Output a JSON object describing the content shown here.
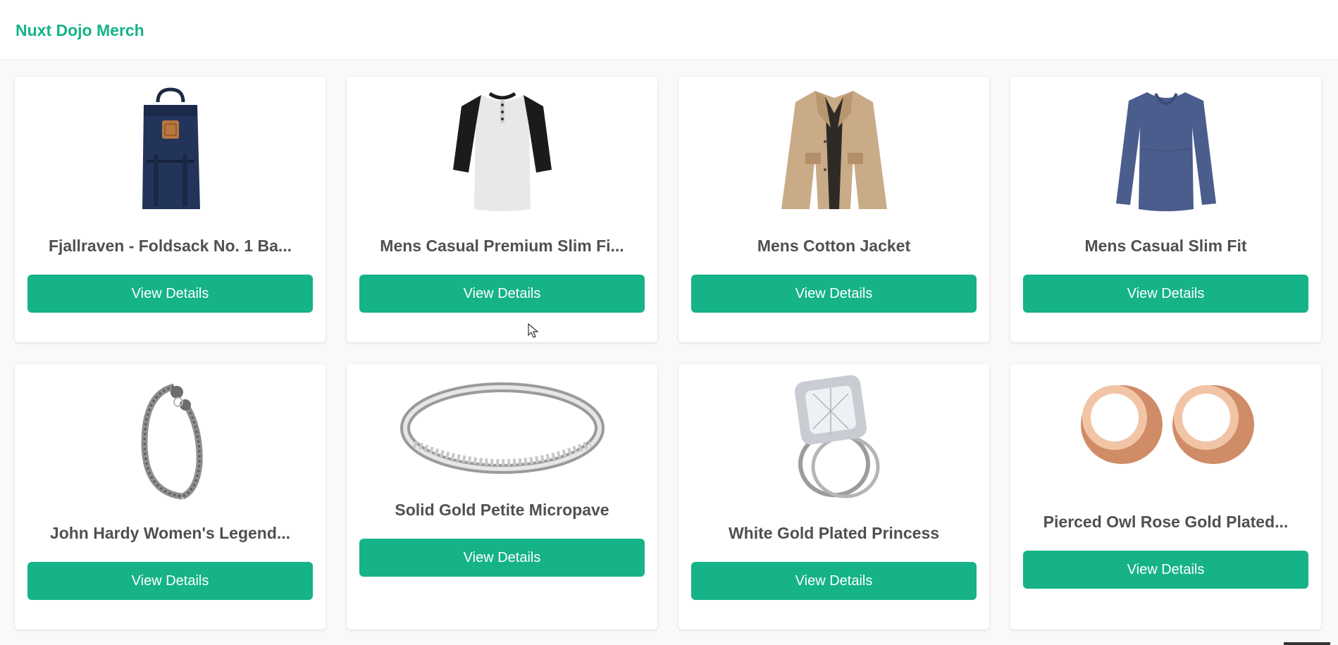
{
  "site": {
    "brand": "Nuxt Dojo Merch"
  },
  "products": [
    {
      "title": "Fjallraven - Foldsack No. 1 Ba...",
      "button": "View Details",
      "image": "backpack-image"
    },
    {
      "title": "Mens Casual Premium Slim Fi...",
      "button": "View Details",
      "image": "raglan-tshirt-image"
    },
    {
      "title": "Mens Cotton Jacket",
      "button": "View Details",
      "image": "cotton-jacket-image"
    },
    {
      "title": "Mens Casual Slim Fit",
      "button": "View Details",
      "image": "long-sleeve-shirt-image"
    },
    {
      "title": "John Hardy Women's Legend...",
      "button": "View Details",
      "image": "dragon-bracelet-image"
    },
    {
      "title": "Solid Gold Petite Micropave",
      "button": "View Details",
      "image": "micropave-ring-image"
    },
    {
      "title": "White Gold Plated Princess",
      "button": "View Details",
      "image": "princess-ring-image"
    },
    {
      "title": "Pierced Owl Rose Gold Plated...",
      "button": "View Details",
      "image": "rose-gold-tunnels-image"
    }
  ],
  "colors": {
    "accent": "#15b387",
    "title_text": "#505050",
    "page_bg": "#f9f9f9"
  }
}
